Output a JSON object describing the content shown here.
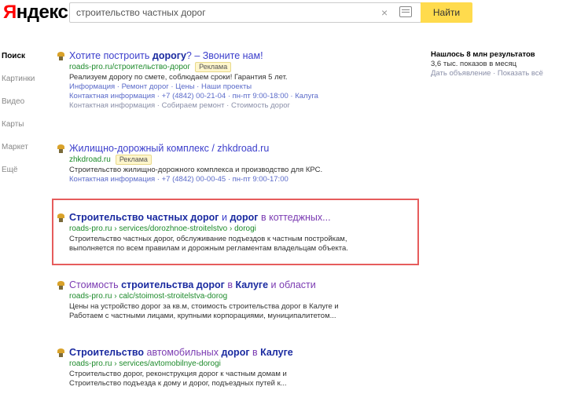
{
  "header": {
    "logo_first": "Я",
    "logo_rest": "ндекс",
    "search_value": "строительство частных дорог",
    "find_label": "Найти"
  },
  "nav": [
    "Поиск",
    "Картинки",
    "Видео",
    "Карты",
    "Маркет",
    "Ещё"
  ],
  "results": [
    {
      "title_a": "Хотите построить ",
      "title_b": "дорогу",
      "title_c": "? – Звоните нам!",
      "url": "roads-pro.ru/строительство-дорог",
      "badge": "Реклама",
      "text": "Реализуем дорогу по смете, соблюдаем сроки! Гарантия 5 лет.",
      "links1": "Информация · Ремонт дорог · Цены · Наши проекты",
      "links2": "Контактная информация · +7 (4842) 00-21-04 · пн-пт 9:00-18:00 · Калуга",
      "links3": "Контактная информация · Собираем ремонт · Стоимость дорог"
    },
    {
      "title_a": "Жилищно-дорожный комплекс / ",
      "title_b": "",
      "title_c": "zhkdroad.ru",
      "url": "zhkdroad.ru",
      "badge": "Реклама",
      "text": "Строительство жилищно-дорожного комплекса и производство для КРС.",
      "links1": "Контактная информация · +7 (4842) 00-00-45 · пн-пт 9:00-17:00",
      "links2": "",
      "links3": ""
    },
    {
      "title_a": "Строительство частных дорог",
      "title_b": " и ",
      "title_c": "дорог",
      "title_d": " в коттеджных...",
      "url": "roads-pro.ru › services/dorozhnoe-stroitelstvo › dorogi",
      "text1": "Строительство частных дорог, обслуживание подъездов к частным постройкам,",
      "text2": "выполняется по всем правилам и дорожным регламентам владельцам объекта."
    },
    {
      "title_a": "Стоимость ",
      "title_b": "строительства дорог",
      "title_c": " в ",
      "title_d": "Калуге",
      "title_e": " и области",
      "url": "roads-pro.ru › calc/stoimost-stroitelstva-dorog",
      "text1": "Цены на устройство дорог за кв.м, стоимость строительства дорог в Калуге и",
      "text2": "Работаем с частными лицами, крупными корпорациями, муниципалитетом..."
    },
    {
      "title_a": "Строительство",
      "title_b": " автомобильных ",
      "title_c": "дорог",
      "title_d": " в ",
      "title_e": "Калуге",
      "url": "roads-pro.ru › services/avtomobilnye-dorogi",
      "text1": "Строительство дорог, реконструкция дорог к частным домам и",
      "text2": "Строительство подъезда к дому и дорог, подъездных путей к..."
    }
  ],
  "side": {
    "title": "Нашлось 8 млн результатов",
    "text": "3,6 тыс. показов в месяц",
    "link": "Дать объявление · Показать всё"
  }
}
